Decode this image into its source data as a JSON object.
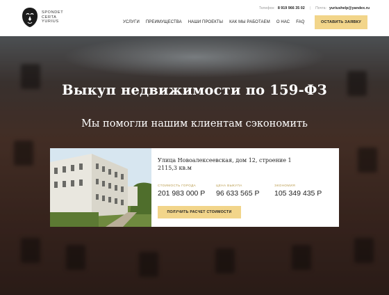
{
  "brand": {
    "lines": [
      "SPONDET",
      "CERTA",
      "YURIUS"
    ]
  },
  "contacts": {
    "phone_label": "Телефон:",
    "phone": "8 919 966 35 02",
    "separator": "|",
    "mail_label": "Почта:",
    "email": "yuriushelp@yandex.ru"
  },
  "nav": {
    "items": [
      "УСЛУГИ",
      "ПРЕИМУЩЕСТВА",
      "НАШИ ПРОЕКТЫ",
      "КАК МЫ РАБОТАЕМ",
      "О НАС",
      "FAQ"
    ]
  },
  "header_cta": "ОСТАВИТЬ ЗАЯВКУ",
  "hero": {
    "title": "Выкуп недвижимости по 159-ФЗ",
    "subtitle": "Мы помогли нашим клиентам сэкономить"
  },
  "card": {
    "address": "Улица Новоалексеевская, дом 12, строение 1",
    "area": "2115,3 кв.м",
    "stats": [
      {
        "label": "СТОИМОСТЬ ГОРОДА",
        "value": "201 983 000 Р"
      },
      {
        "label": "ЦЕНА ВЫКУПА",
        "value": "96 633 565 Р"
      },
      {
        "label": "ЭКОНОМИЯ",
        "value": "105 349 435 Р"
      }
    ],
    "button": "ПОЛУЧИТЬ РАСЧЕТ СТОИМОСТИ"
  },
  "colors": {
    "accent": "#f2d58a",
    "label_gold": "#b99a4a",
    "header_bg": "#ffffff"
  }
}
